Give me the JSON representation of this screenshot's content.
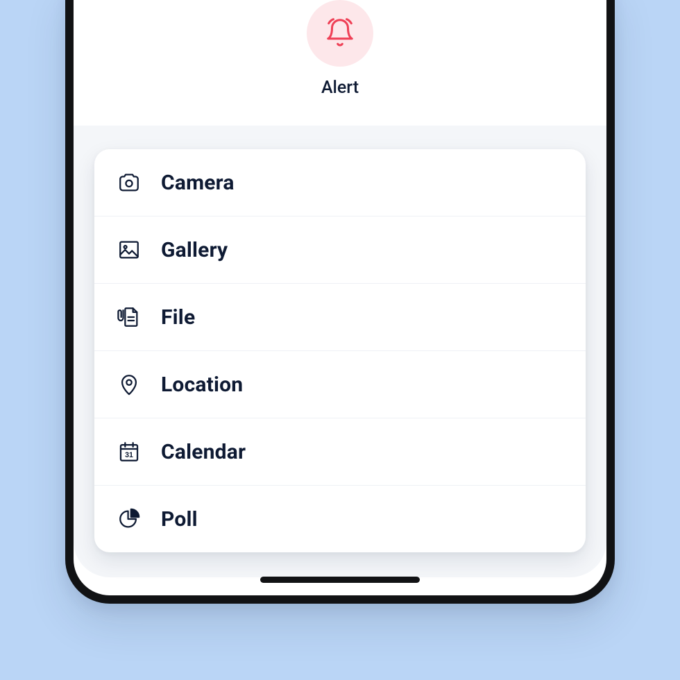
{
  "header": {
    "alert_label": "Alert",
    "icon_accent": "#ef4056",
    "icon_bg": "#fde7ea"
  },
  "menu": {
    "items": [
      {
        "label": "Camera",
        "icon": "camera-icon"
      },
      {
        "label": "Gallery",
        "icon": "gallery-icon"
      },
      {
        "label": "File",
        "icon": "file-icon"
      },
      {
        "label": "Location",
        "icon": "location-icon"
      },
      {
        "label": "Calendar",
        "icon": "calendar-icon"
      },
      {
        "label": "Poll",
        "icon": "poll-icon"
      }
    ]
  },
  "colors": {
    "ink": "#0e1a33",
    "page_bg": "#bad5f6",
    "sheet_bg": "#f4f6f9",
    "divider": "#eef1f5"
  }
}
